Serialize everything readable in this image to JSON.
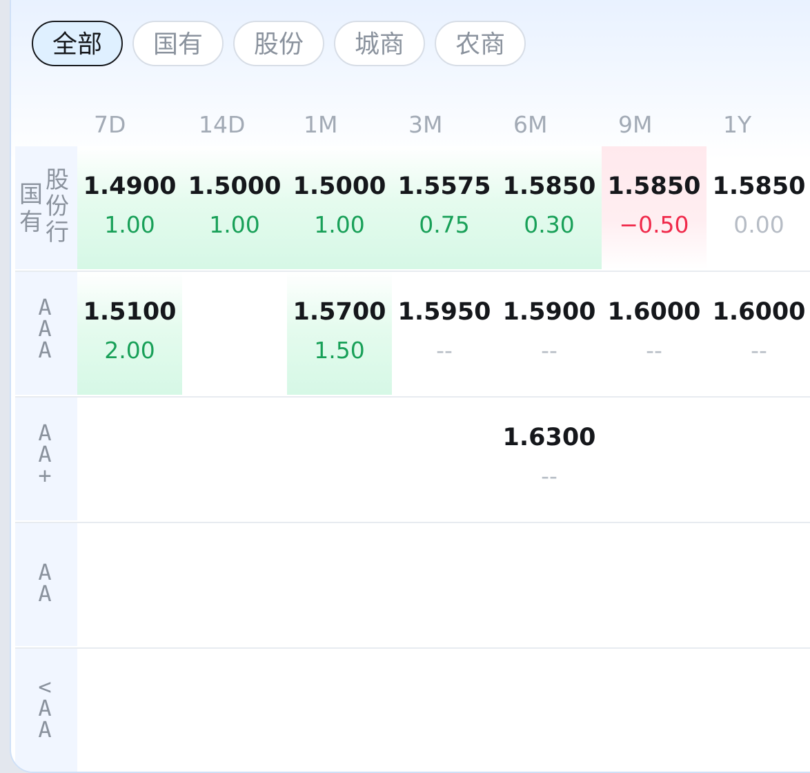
{
  "tabs": [
    {
      "label": "全部",
      "active": true
    },
    {
      "label": "国有",
      "active": false
    },
    {
      "label": "股份",
      "active": false
    },
    {
      "label": "城商",
      "active": false
    },
    {
      "label": "农商",
      "active": false
    }
  ],
  "columns": [
    "7D",
    "14D",
    "1M",
    "3M",
    "6M",
    "9M",
    "1Y"
  ],
  "colors": {
    "up": "#18a058",
    "down": "#f0294a",
    "neutral": "#b6bcc5",
    "active_tab_bg": "#dff0ff"
  },
  "rows": [
    {
      "label_main": "国有",
      "label_sub": "股份行",
      "cells": [
        {
          "rate": "1.4900",
          "change": "1.00"
        },
        {
          "rate": "1.5000",
          "change": "1.00"
        },
        {
          "rate": "1.5000",
          "change": "1.00"
        },
        {
          "rate": "1.5575",
          "change": "0.75"
        },
        {
          "rate": "1.5850",
          "change": "0.30"
        },
        {
          "rate": "1.5850",
          "change": "−0.50"
        },
        {
          "rate": "1.5850",
          "change": "0.00"
        }
      ]
    },
    {
      "label": "AAA",
      "cells": [
        {
          "rate": "1.5100",
          "change": "2.00"
        },
        {
          "rate": "",
          "change": ""
        },
        {
          "rate": "1.5700",
          "change": "1.50"
        },
        {
          "rate": "1.5950",
          "change": "--"
        },
        {
          "rate": "1.5900",
          "change": "--"
        },
        {
          "rate": "1.6000",
          "change": "--"
        },
        {
          "rate": "1.6000",
          "change": "--"
        }
      ]
    },
    {
      "label": "AA+",
      "cells": [
        {
          "rate": "",
          "change": ""
        },
        {
          "rate": "",
          "change": ""
        },
        {
          "rate": "",
          "change": ""
        },
        {
          "rate": "",
          "change": ""
        },
        {
          "rate": "1.6300",
          "change": "--"
        },
        {
          "rate": "",
          "change": ""
        },
        {
          "rate": "",
          "change": ""
        }
      ]
    },
    {
      "label": "AA",
      "cells": [
        {
          "rate": "",
          "change": ""
        },
        {
          "rate": "",
          "change": ""
        },
        {
          "rate": "",
          "change": ""
        },
        {
          "rate": "",
          "change": ""
        },
        {
          "rate": "",
          "change": ""
        },
        {
          "rate": "",
          "change": ""
        },
        {
          "rate": "",
          "change": ""
        }
      ]
    },
    {
      "label": "<AA",
      "cells": [
        {
          "rate": "",
          "change": ""
        },
        {
          "rate": "",
          "change": ""
        },
        {
          "rate": "",
          "change": ""
        },
        {
          "rate": "",
          "change": ""
        },
        {
          "rate": "",
          "change": ""
        },
        {
          "rate": "",
          "change": ""
        },
        {
          "rate": "",
          "change": ""
        }
      ]
    }
  ]
}
